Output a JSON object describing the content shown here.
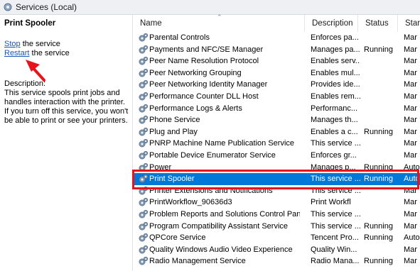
{
  "window": {
    "title": "Services (Local)"
  },
  "left_panel": {
    "service_name": "Print Spooler",
    "stop_link": "Stop",
    "stop_suffix": " the service",
    "restart_link": "Restart",
    "restart_suffix": " the service",
    "description_label": "Description:",
    "description_text": "This service spools print jobs and handles interaction with the printer. If you turn off this service, you won't be able to print or see your printers."
  },
  "columns": {
    "name": "Name",
    "description": "Description",
    "status": "Status",
    "startup": "Star"
  },
  "rows": [
    {
      "name": "Parental Controls",
      "description": "Enforces pa...",
      "status": "",
      "startup": "Mar"
    },
    {
      "name": "Payments and NFC/SE Manager",
      "description": "Manages pa...",
      "status": "Running",
      "startup": "Mar"
    },
    {
      "name": "Peer Name Resolution Protocol",
      "description": "Enables serv...",
      "status": "",
      "startup": "Mar"
    },
    {
      "name": "Peer Networking Grouping",
      "description": "Enables mul...",
      "status": "",
      "startup": "Mar"
    },
    {
      "name": "Peer Networking Identity Manager",
      "description": "Provides ide...",
      "status": "",
      "startup": "Mar"
    },
    {
      "name": "Performance Counter DLL Host",
      "description": "Enables rem...",
      "status": "",
      "startup": "Mar"
    },
    {
      "name": "Performance Logs & Alerts",
      "description": "Performanc...",
      "status": "",
      "startup": "Mar"
    },
    {
      "name": "Phone Service",
      "description": "Manages th...",
      "status": "",
      "startup": "Mar"
    },
    {
      "name": "Plug and Play",
      "description": "Enables a c...",
      "status": "Running",
      "startup": "Mar"
    },
    {
      "name": "PNRP Machine Name Publication Service",
      "description": "This service ...",
      "status": "",
      "startup": "Mar"
    },
    {
      "name": "Portable Device Enumerator Service",
      "description": "Enforces gr...",
      "status": "",
      "startup": "Mar"
    },
    {
      "name": "Power",
      "description": "Manages p...",
      "status": "Running",
      "startup": "Auto"
    },
    {
      "name": "Print Spooler",
      "description": "This service ...",
      "status": "Running",
      "startup": "Auto"
    },
    {
      "name": "Printer Extensions and Notifications",
      "description": "This service ...",
      "status": "",
      "startup": "Mar"
    },
    {
      "name": "PrintWorkflow_90636d3",
      "description": "Print Workfl",
      "status": "",
      "startup": "Mar"
    },
    {
      "name": "Problem Reports and Solutions Control Panel...",
      "description": "This service ...",
      "status": "",
      "startup": "Mar"
    },
    {
      "name": "Program Compatibility Assistant Service",
      "description": "This service ...",
      "status": "Running",
      "startup": "Mar"
    },
    {
      "name": "QPCore Service",
      "description": "Tencent Pro...",
      "status": "Running",
      "startup": "Auto"
    },
    {
      "name": "Quality Windows Audio Video Experience",
      "description": "Quality Win...",
      "status": "",
      "startup": "Mar"
    },
    {
      "name": "Radio Management Service",
      "description": "Radio Mana...",
      "status": "Running",
      "startup": "Mar"
    }
  ],
  "selected_index": 12,
  "colors": {
    "selection": "#0078d7",
    "annotation": "#e8141c",
    "link": "#1a56b8"
  }
}
